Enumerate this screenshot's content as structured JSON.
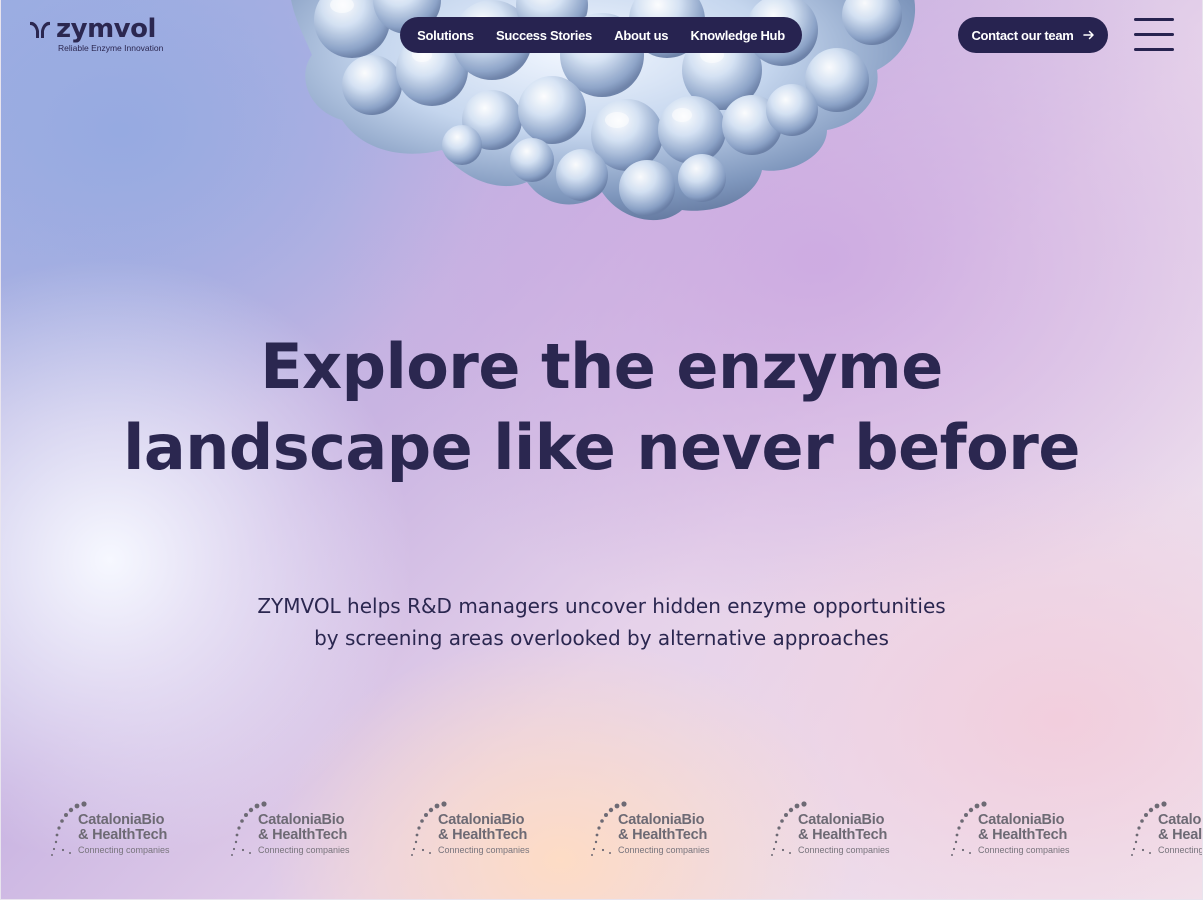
{
  "brand": {
    "name": "zymvol",
    "tagline": "Reliable Enzyme Innovation",
    "color": "#2b2750"
  },
  "nav": {
    "items": [
      {
        "label": "Solutions"
      },
      {
        "label": "Success Stories"
      },
      {
        "label": "About us"
      },
      {
        "label": "Knowledge Hub"
      }
    ],
    "cta_label": "Contact our team"
  },
  "hero": {
    "title_line1": "Explore the enzyme",
    "title_line2": "landscape like never before",
    "subtitle_line1": "ZYMVOL helps R&D managers uncover hidden enzyme opportunities",
    "subtitle_line2": "by screening areas overlooked by alternative approaches"
  },
  "partners": [
    {
      "line1": "CataloniaBio",
      "line2": "& HealthTech",
      "line3": "Connecting companies"
    },
    {
      "line1": "CataloniaBio",
      "line2": "& HealthTech",
      "line3": "Connecting companies"
    },
    {
      "line1": "CataloniaBio",
      "line2": "& HealthTech",
      "line3": "Connecting companies"
    },
    {
      "line1": "CataloniaBio",
      "line2": "& HealthTech",
      "line3": "Connecting companies"
    },
    {
      "line1": "CataloniaBio",
      "line2": "& HealthTech",
      "line3": "Connecting companies"
    },
    {
      "line1": "CataloniaBio",
      "line2": "& HealthTech",
      "line3": "Connecting companies"
    },
    {
      "line1": "CataloniaBio",
      "line2": "& HealthTech",
      "line3": "Connecting companies"
    }
  ],
  "icons": {
    "logo": "zymvol-logo-icon",
    "cta": "arrow-right-icon",
    "menu": "hamburger-menu-icon",
    "partner": "cataloniabio-dots-icon",
    "hero": "protein-blob-image"
  },
  "colors": {
    "primary": "#272350",
    "text": "#2b2750",
    "partner_gray": "#6d6a74"
  }
}
